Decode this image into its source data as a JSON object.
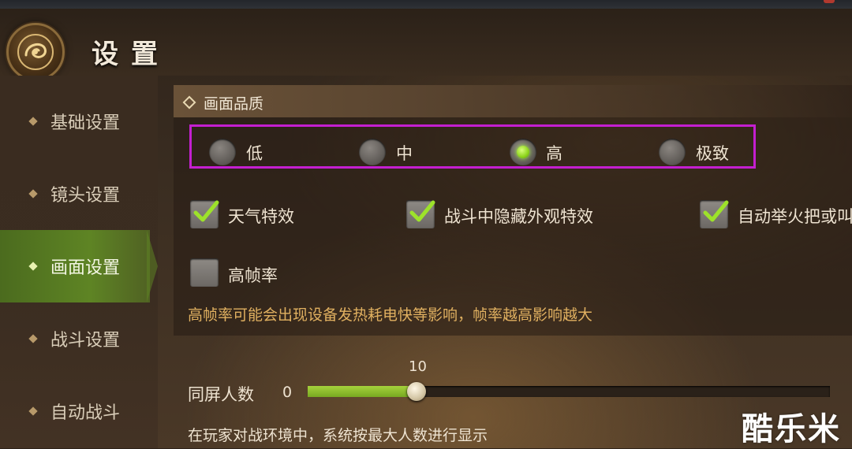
{
  "header": {
    "title": "设置"
  },
  "sidebar": {
    "items": [
      {
        "label": "基础设置"
      },
      {
        "label": "镜头设置"
      },
      {
        "label": "画面设置"
      },
      {
        "label": "战斗设置"
      },
      {
        "label": "自动战斗"
      }
    ],
    "active_index": 2
  },
  "section": {
    "title": "画面品质"
  },
  "quality": {
    "options": [
      "低",
      "中",
      "高",
      "极致"
    ],
    "selected": "高"
  },
  "checkboxes": [
    {
      "label": "天气特效",
      "checked": true
    },
    {
      "label": "战斗中隐藏外观特效",
      "checked": true
    },
    {
      "label": "自动举火把或叫",
      "checked": true
    },
    {
      "label": "高帧率",
      "checked": false
    }
  ],
  "hint": "高帧率可能会出现设备发热耗电快等影响，帧率越高影响越大",
  "slider": {
    "label": "同屏人数",
    "min_label": "0",
    "value_label": "10",
    "fill_fraction": 0.21,
    "description": "在玩家对战环境中，系统按最大人数进行显示"
  },
  "watermark": "酷乐米",
  "colors": {
    "accent_green": "#8dd41c",
    "highlight_box": "#c41fd0",
    "hint_text": "#e0b060"
  }
}
